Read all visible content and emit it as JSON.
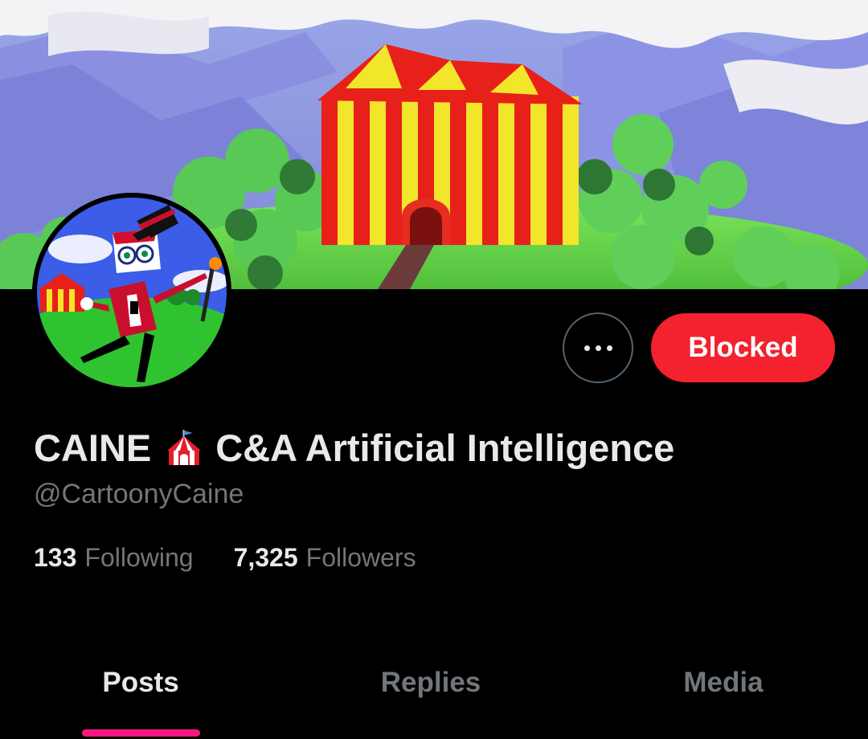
{
  "profile": {
    "display_name": "CAINE",
    "display_name_suffix": "C&A Artificial Intelligence",
    "handle": "@CartoonyCaine",
    "name_emoji_icon": "circus-tent-icon"
  },
  "stats": {
    "following_count": "133",
    "following_label": "Following",
    "followers_count": "7,325",
    "followers_label": "Followers"
  },
  "actions": {
    "more_icon": "more-horizontal-icon",
    "blocked_label": "Blocked"
  },
  "tabs": [
    {
      "label": "Posts",
      "active": true
    },
    {
      "label": "Replies",
      "active": false
    },
    {
      "label": "Media",
      "active": false
    }
  ],
  "colors": {
    "background": "#000000",
    "blocked_button": "#f4212e",
    "tab_indicator": "#f91880",
    "secondary_text": "#71767b",
    "primary_text": "#e7e9ea"
  }
}
